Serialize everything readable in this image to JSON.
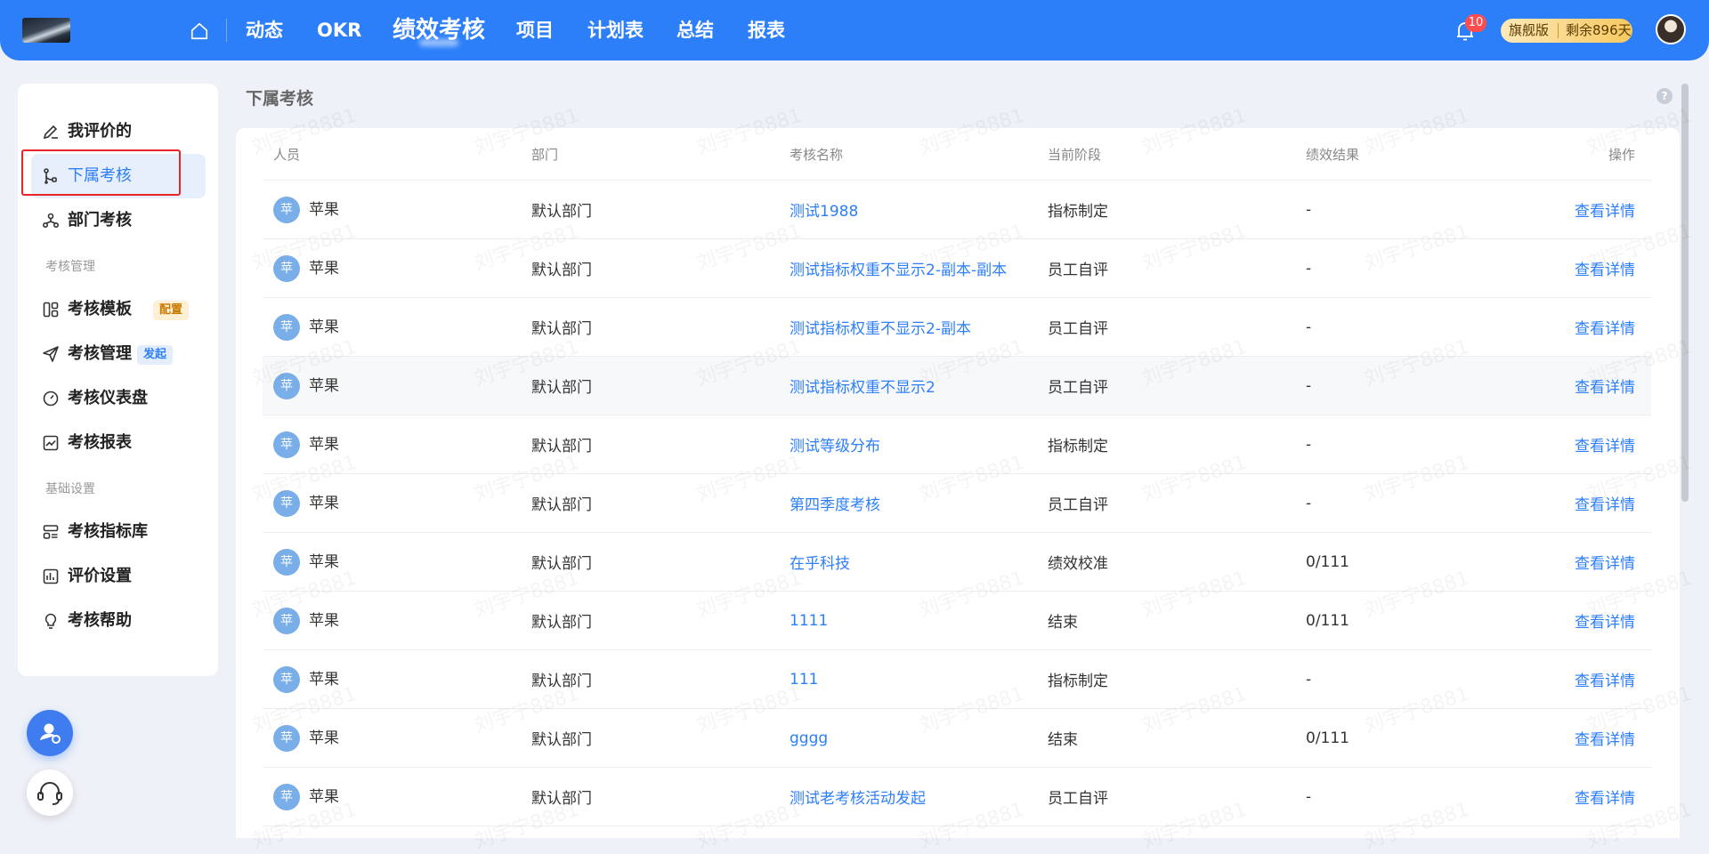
{
  "header": {
    "nav": [
      "动态",
      "OKR",
      "绩效考核",
      "项目",
      "计划表",
      "总结",
      "报表"
    ],
    "active_nav": "绩效考核",
    "notification_count": "10",
    "plan_name": "旗舰版",
    "plan_remaining": "剩余896天"
  },
  "sidebar": {
    "items_top": [
      {
        "label": "我评价的",
        "icon": "edit-icon"
      },
      {
        "label": "下属考核",
        "icon": "branch-icon"
      },
      {
        "label": "部门考核",
        "icon": "org-icon"
      }
    ],
    "group_manage": "考核管理",
    "items_manage": [
      {
        "label": "考核模板",
        "icon": "template-icon",
        "tag": "配置"
      },
      {
        "label": "考核管理",
        "icon": "send-icon",
        "tag": "发起"
      },
      {
        "label": "考核仪表盘",
        "icon": "gauge-icon"
      },
      {
        "label": "考核报表",
        "icon": "chart-icon"
      }
    ],
    "group_settings": "基础设置",
    "items_settings": [
      {
        "label": "考核指标库",
        "icon": "indicator-icon"
      },
      {
        "label": "评价设置",
        "icon": "settings-chart-icon"
      },
      {
        "label": "考核帮助",
        "icon": "bulb-icon"
      }
    ]
  },
  "main": {
    "title": "下属考核",
    "columns": [
      "人员",
      "部门",
      "考核名称",
      "当前阶段",
      "绩效结果",
      "操作"
    ],
    "rows": [
      {
        "avatar": "苹",
        "person": "苹果",
        "dept": "默认部门",
        "name": "测试1988",
        "stage": "指标制定",
        "result": "-",
        "action": "查看详情"
      },
      {
        "avatar": "苹",
        "person": "苹果",
        "dept": "默认部门",
        "name": "测试指标权重不显示2-副本-副本",
        "stage": "员工自评",
        "result": "-",
        "action": "查看详情"
      },
      {
        "avatar": "苹",
        "person": "苹果",
        "dept": "默认部门",
        "name": "测试指标权重不显示2-副本",
        "stage": "员工自评",
        "result": "-",
        "action": "查看详情"
      },
      {
        "avatar": "苹",
        "person": "苹果",
        "dept": "默认部门",
        "name": "测试指标权重不显示2",
        "stage": "员工自评",
        "result": "-",
        "action": "查看详情"
      },
      {
        "avatar": "苹",
        "person": "苹果",
        "dept": "默认部门",
        "name": "测试等级分布",
        "stage": "指标制定",
        "result": "-",
        "action": "查看详情"
      },
      {
        "avatar": "苹",
        "person": "苹果",
        "dept": "默认部门",
        "name": "第四季度考核",
        "stage": "员工自评",
        "result": "-",
        "action": "查看详情"
      },
      {
        "avatar": "苹",
        "person": "苹果",
        "dept": "默认部门",
        "name": "在乎科技",
        "stage": "绩效校准",
        "result": "0/111",
        "action": "查看详情"
      },
      {
        "avatar": "苹",
        "person": "苹果",
        "dept": "默认部门",
        "name": "1111",
        "stage": "结束",
        "result": "0/111",
        "action": "查看详情"
      },
      {
        "avatar": "苹",
        "person": "苹果",
        "dept": "默认部门",
        "name": "111",
        "stage": "指标制定",
        "result": "-",
        "action": "查看详情"
      },
      {
        "avatar": "苹",
        "person": "苹果",
        "dept": "默认部门",
        "name": "gggg",
        "stage": "结束",
        "result": "0/111",
        "action": "查看详情"
      },
      {
        "avatar": "苹",
        "person": "苹果",
        "dept": "默认部门",
        "name": "测试老考核活动发起",
        "stage": "员工自评",
        "result": "-",
        "action": "查看详情"
      }
    ]
  },
  "watermark": "刘宇宁8881",
  "colors": {
    "primary": "#2d7ff9",
    "highlight_border": "#e8252b"
  }
}
